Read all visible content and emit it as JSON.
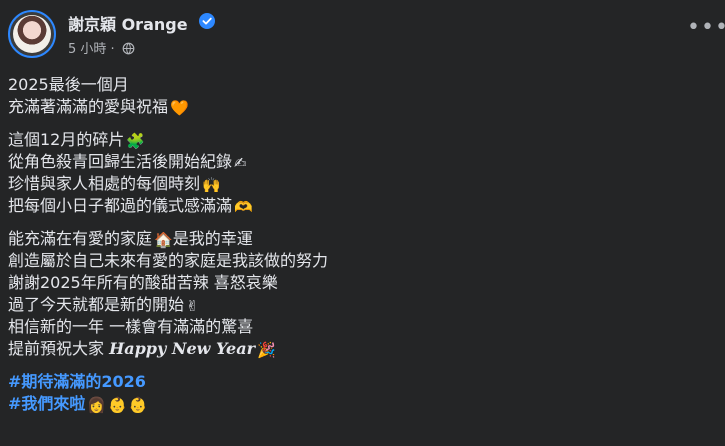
{
  "post": {
    "author": "謝京穎 Orange",
    "time": "5 小時",
    "separator": "·",
    "more_label": "•••",
    "icons": {
      "verified": "verified-badge-icon",
      "audience": "globe-icon",
      "more": "more-options-icon"
    },
    "lines": [
      "2025最後一個月",
      "充滿著滿滿的愛與祝福",
      "這個12月的碎片",
      "從角色殺青回歸生活後開始紀錄",
      "珍惜與家人相處的每個時刻",
      "把每個小日子都過的儀式感滿滿",
      "能充滿在有愛的家庭",
      "是我的幸運",
      "創造屬於自己未來有愛的家庭是我該做的努力",
      "謝謝2025年所有的酸甜苦辣 喜怒哀樂",
      "過了今天就都是新的開始",
      "相信新的一年 一樣會有滿滿的驚喜",
      "提前預祝大家",
      "Happy New Year"
    ],
    "hashtags": [
      "#期待滿滿的2026",
      "#我們來啦"
    ],
    "emojis": {
      "heart": "🧡",
      "puzzle": "🧩",
      "writing": "✍",
      "hands": "🙌",
      "heart_hands": "🫶",
      "house": "🏠",
      "victory": "✌",
      "party": "🎉",
      "woman": "👩",
      "baby": "👶"
    },
    "colors": {
      "background": "#242526",
      "text": "#e4e6eb",
      "secondary": "#b0b3b8",
      "link": "#4599ff",
      "verified": "#2d88ff"
    }
  }
}
